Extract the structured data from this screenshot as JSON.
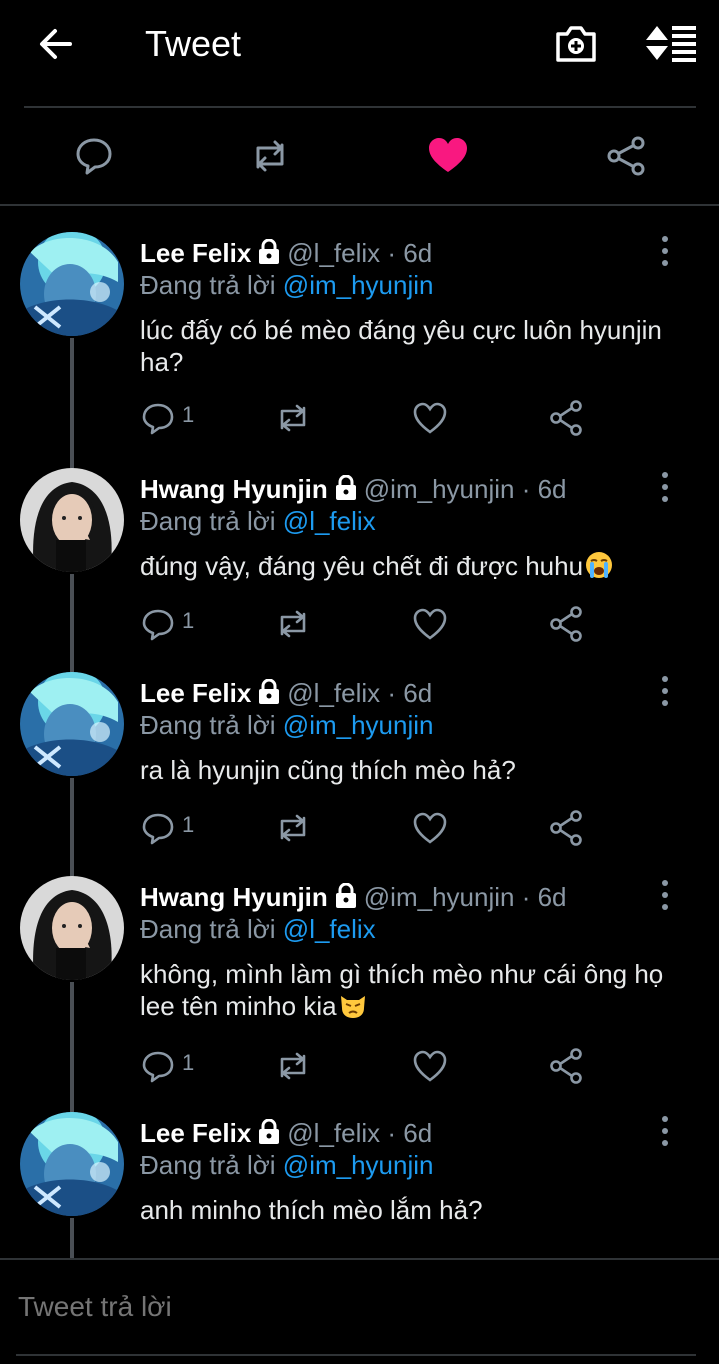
{
  "header": {
    "title": "Tweet"
  },
  "tweets": [
    {
      "name": "Lee Felix",
      "handle": "@l_felix",
      "time": "6d",
      "reply_prefix": "Đang trả lời",
      "reply_to": "@im_hyunjin",
      "text": "lúc đấy có bé mèo đáng yêu cực luôn hyunjin ha?",
      "reply_count": "1",
      "avatar": "felix-avatar"
    },
    {
      "name": "Hwang Hyunjin",
      "handle": "@im_hyunjin",
      "time": "6d",
      "reply_prefix": "Đang trả lời",
      "reply_to": "@l_felix",
      "text": "đúng vậy, đáng yêu chết đi được huhu",
      "emoji": "loudly-crying-face",
      "reply_count": "1",
      "avatar": "hyunjin-avatar"
    },
    {
      "name": "Lee Felix",
      "handle": "@l_felix",
      "time": "6d",
      "reply_prefix": "Đang trả lời",
      "reply_to": "@im_hyunjin",
      "text": "ra là hyunjin cũng thích mèo hả?",
      "reply_count": "1",
      "avatar": "felix-avatar"
    },
    {
      "name": "Hwang Hyunjin",
      "handle": "@im_hyunjin",
      "time": "6d",
      "reply_prefix": "Đang trả lời",
      "reply_to": "@l_felix",
      "text": "không, mình làm gì thích mèo như cái ông họ lee tên minho kia",
      "emoji": "pouting-cat-face",
      "reply_count": "1",
      "avatar": "hyunjin-avatar"
    },
    {
      "name": "Lee Felix",
      "handle": "@l_felix",
      "time": "6d",
      "reply_prefix": "Đang trả lời",
      "reply_to": "@im_hyunjin",
      "text": "anh minho thích mèo lắm hả?",
      "reply_count": "",
      "avatar": "felix-avatar"
    }
  ],
  "reply_box": {
    "placeholder": "Tweet trả lời"
  },
  "colors": {
    "like": "#f91880",
    "mention": "#1d9bf0",
    "muted": "#8b98a5"
  }
}
